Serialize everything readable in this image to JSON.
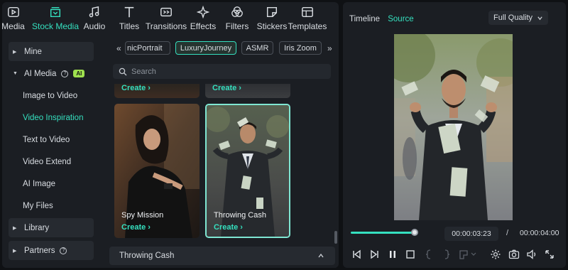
{
  "toolbar": {
    "items": [
      {
        "label": "Media",
        "icon": "media-icon"
      },
      {
        "label": "Stock Media",
        "icon": "stock-media-icon",
        "active": true
      },
      {
        "label": "Audio",
        "icon": "music-note-icon"
      },
      {
        "label": "Titles",
        "icon": "text-t-icon"
      },
      {
        "label": "Transitions",
        "icon": "transitions-icon"
      },
      {
        "label": "Effects",
        "icon": "sparkle-icon"
      },
      {
        "label": "Filters",
        "icon": "filters-icon"
      },
      {
        "label": "Stickers",
        "icon": "sticker-icon"
      },
      {
        "label": "Templates",
        "icon": "templates-icon"
      }
    ]
  },
  "sidebar": {
    "mine": "Mine",
    "ai_media": "AI Media",
    "ai_badge": "AI",
    "items": [
      {
        "label": "Image to Video"
      },
      {
        "label": "Video Inspiration",
        "active": true
      },
      {
        "label": "Text to Video"
      },
      {
        "label": "Video Extend"
      },
      {
        "label": "AI Image"
      },
      {
        "label": "My Files"
      }
    ],
    "library": "Library",
    "partners": "Partners"
  },
  "content": {
    "tags": [
      "nicPortrait",
      "LuxuryJourney",
      "ASMR",
      "Iris Zoom"
    ],
    "active_tag": "LuxuryJourney",
    "search_placeholder": "Search",
    "cards_top": [
      {
        "create": "Create"
      },
      {
        "create": "Create"
      }
    ],
    "cards": [
      {
        "title": "Spy Mission",
        "create": "Create"
      },
      {
        "title": "Throwing Cash",
        "create": "Create",
        "selected": true
      }
    ],
    "footer_title": "Throwing Cash"
  },
  "preview": {
    "tabs": [
      "Timeline",
      "Source"
    ],
    "active_tab": "Source",
    "quality": "Full Quality",
    "current_time": "00:00:03:23",
    "separator": "/",
    "total_time": "00:00:04:00",
    "progress": 0.96
  },
  "colors": {
    "accent": "#35e0bf",
    "ai_badge": "#9ee04e",
    "panel": "#1b1e23",
    "background": "#0f1114"
  }
}
